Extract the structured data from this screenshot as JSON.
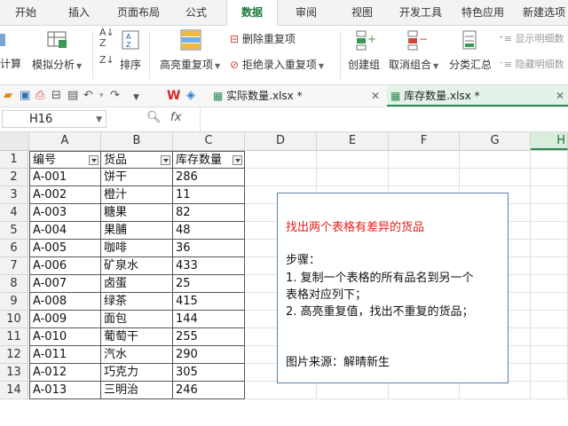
{
  "menu_tabs": [
    {
      "label": "开始"
    },
    {
      "label": "插入"
    },
    {
      "label": "页面布局"
    },
    {
      "label": "公式"
    },
    {
      "label": "数据",
      "active": true
    },
    {
      "label": "审阅"
    },
    {
      "label": "视图"
    },
    {
      "label": "开发工具"
    },
    {
      "label": "特色应用"
    },
    {
      "label": "新建选项"
    }
  ],
  "ribbon": {
    "calc_partial": "计算",
    "what_if": "模拟分析",
    "sort": "排序",
    "highlight_dup": "高亮重复项",
    "remove_dup": "删除重复项",
    "reject_dup": "拒绝录入重复项",
    "create_group": "创建组",
    "ungroup": "取消组合",
    "subtotal": "分类汇总",
    "show_detail": "显示明细数",
    "hide_detail": "隐藏明细数"
  },
  "doc_tabs": [
    {
      "label": "实际数量.xlsx *"
    },
    {
      "label": "库存数量.xlsx *",
      "active": true
    }
  ],
  "formula_bar": {
    "cell_ref": "H16",
    "fx": "fx",
    "formula": ""
  },
  "columns": [
    "A",
    "B",
    "C",
    "D",
    "E",
    "F",
    "G",
    "H"
  ],
  "selected_column": "H",
  "table": {
    "headers": [
      "编号",
      "货品",
      "库存数量"
    ],
    "rows": [
      [
        "A-001",
        "饼干",
        "286"
      ],
      [
        "A-002",
        "橙汁",
        "11"
      ],
      [
        "A-003",
        "糖果",
        "82"
      ],
      [
        "A-004",
        "果脯",
        "48"
      ],
      [
        "A-005",
        "咖啡",
        "36"
      ],
      [
        "A-006",
        "矿泉水",
        "433"
      ],
      [
        "A-007",
        "卤蛋",
        "25"
      ],
      [
        "A-008",
        "绿茶",
        "415"
      ],
      [
        "A-009",
        "面包",
        "144"
      ],
      [
        "A-010",
        "葡萄干",
        "255"
      ],
      [
        "A-011",
        "汽水",
        "290"
      ],
      [
        "A-012",
        "巧克力",
        "305"
      ],
      [
        "A-013",
        "三明治",
        "246"
      ]
    ]
  },
  "row_numbers": [
    "1",
    "2",
    "3",
    "4",
    "5",
    "6",
    "7",
    "8",
    "9",
    "10",
    "11",
    "12",
    "13",
    "14"
  ],
  "textbox": {
    "title": "找出两个表格有差异的货品",
    "steps_label": "步骤：",
    "line1": "1. 复制一个表格的所有品名到另一个",
    "line2": "表格对应列下；",
    "line3": "2. 高亮重复值，找出不重复的货品；",
    "source": "图片来源：解晴新生"
  },
  "colors": {
    "accent": "#1a7a3b",
    "title_red": "#e0201a"
  }
}
